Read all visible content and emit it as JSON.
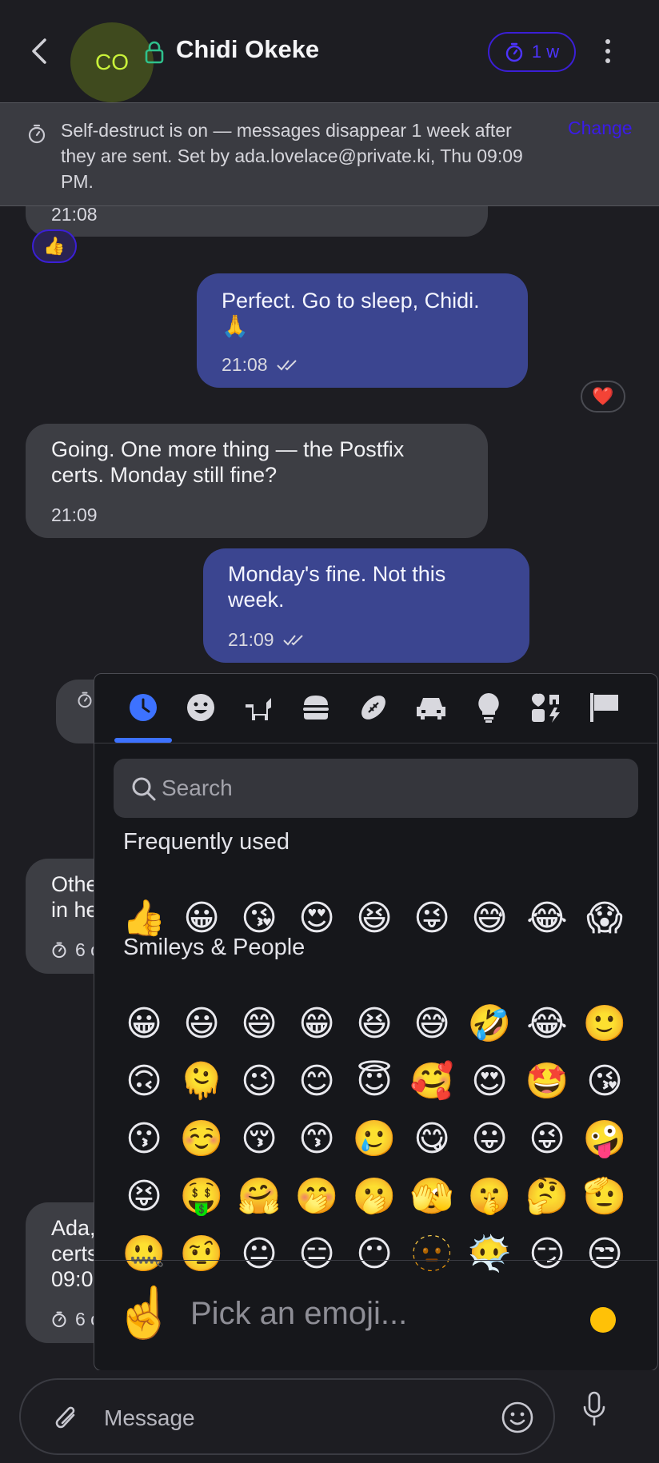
{
  "header": {
    "avatar_initials": "CO",
    "title": "Chidi Okeke",
    "timer_label": "1 w"
  },
  "banner": {
    "text": "Self-destruct is on — messages disappear 1 week after they are sent. Set by ada.lovelace@private.ki, Thu 09:09 PM.",
    "action": "Change"
  },
  "messages": [
    {
      "time": "21:08"
    },
    {
      "text": "Perfect. Go to sleep, Chidi. 🙏",
      "time": "21:08"
    },
    {
      "text": "Going. One more thing — the Postfix certs. Monday still fine?",
      "time": "21:09"
    },
    {
      "text": "Monday's fine. Not this week.",
      "time": "21:09"
    },
    {
      "text": "Othe",
      "text2": "in he",
      "meta": "6 c"
    },
    {
      "text": "Ada,",
      "text2": "certs",
      "text3": "09:0",
      "meta": "6 c"
    }
  ],
  "reactions": {
    "thumbs": "👍",
    "heart": "❤️"
  },
  "picker": {
    "search_placeholder": "Search",
    "frequently_used_label": "Frequently used",
    "smileys_label": "Smileys & People",
    "frequent": [
      "👍",
      "😀",
      "😘",
      "😍",
      "😆",
      "😜",
      "😅",
      "😂",
      "😱"
    ],
    "smileys": [
      [
        "😀",
        "😃",
        "😄",
        "😁",
        "😆",
        "😅",
        "🤣",
        "😂",
        "🙂"
      ],
      [
        "🙃",
        "🫠",
        "😉",
        "😊",
        "😇",
        "🥰",
        "😍",
        "🤩",
        "😘"
      ],
      [
        "😗",
        "☺️",
        "😚",
        "😙",
        "🥲",
        "😋",
        "😛",
        "😜",
        "🤪"
      ],
      [
        "😝",
        "🤑",
        "🤗",
        "🤭",
        "🫢",
        "🫣",
        "🤫",
        "🤔",
        "🫡"
      ],
      [
        "🤐",
        "🤨",
        "😐",
        "😑",
        "😶",
        "🫥",
        "😶‍🌫️",
        "😏",
        "😒"
      ]
    ],
    "foot_emoji": "☝️",
    "foot_placeholder": "Pick an emoji..."
  },
  "composer": {
    "placeholder": "Message"
  },
  "colors": {
    "accent": "#3d72ff",
    "outgoing": "#3b4590",
    "incoming": "#3d3e44",
    "timer": "#4d34ff"
  }
}
